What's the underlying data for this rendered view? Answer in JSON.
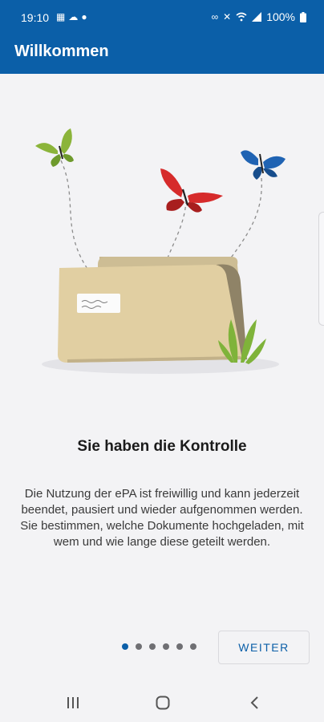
{
  "status_bar": {
    "time": "19:10",
    "battery": "100%",
    "left_icons": [
      "calendar-icon",
      "cloud-icon",
      "bulb-icon"
    ],
    "right_icons": [
      "link-icon",
      "mute-icon",
      "wifi-icon",
      "signal-icon",
      "battery-icon"
    ]
  },
  "app_bar": {
    "title": "Willkommen"
  },
  "onboarding": {
    "headline": "Sie haben die Kontrolle",
    "body": "Die Nutzung der ePA ist freiwillig und kann jederzeit beendet, pausiert und wieder aufgenommen werden. Sie bestimmen, welche Dokumente hochgeladen, mit wem und wie lange diese geteilt werden.",
    "page_count": 6,
    "current_page": 1,
    "next_label": "WEITER"
  },
  "colors": {
    "brand": "#0b5fa8",
    "background": "#f3f3f5",
    "butterfly_green": "#8bb43a",
    "butterfly_red": "#d62b2b",
    "butterfly_blue": "#1f63b3",
    "folder": "#e1cfa2"
  },
  "nav_bar": {
    "icons": [
      "recent-apps-icon",
      "home-icon",
      "back-icon"
    ]
  }
}
